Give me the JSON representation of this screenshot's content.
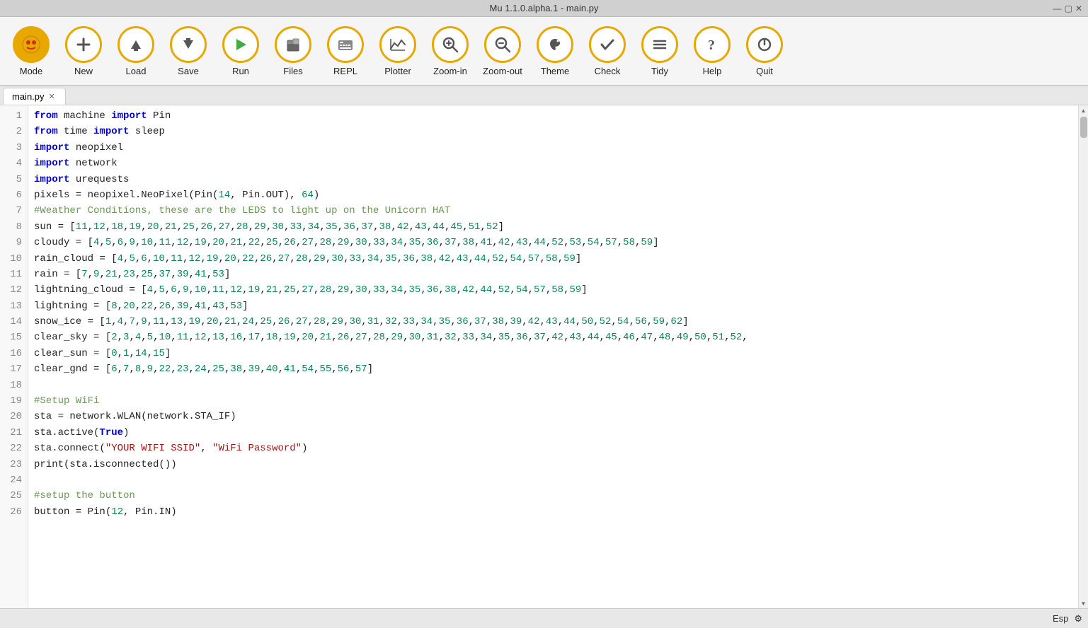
{
  "titleBar": {
    "title": "Mu 1.1.0.alpha.1 - main.py",
    "controls": [
      "▢",
      "—",
      "✕"
    ]
  },
  "toolbar": {
    "buttons": [
      {
        "id": "mode",
        "label": "Mode",
        "icon": "🔴",
        "special": "mode"
      },
      {
        "id": "new",
        "label": "New",
        "icon": "+"
      },
      {
        "id": "load",
        "label": "Load",
        "icon": "⬆"
      },
      {
        "id": "save",
        "label": "Save",
        "icon": "⬇"
      },
      {
        "id": "run",
        "label": "Run",
        "icon": "▶"
      },
      {
        "id": "files",
        "label": "Files",
        "icon": "📁"
      },
      {
        "id": "repl",
        "label": "REPL",
        "icon": "⌨"
      },
      {
        "id": "plotter",
        "label": "Plotter",
        "icon": "📈"
      },
      {
        "id": "zoom-in",
        "label": "Zoom-in",
        "icon": "🔍"
      },
      {
        "id": "zoom-out",
        "label": "Zoom-out",
        "icon": "🔎"
      },
      {
        "id": "theme",
        "label": "Theme",
        "icon": "🌙"
      },
      {
        "id": "check",
        "label": "Check",
        "icon": "👍"
      },
      {
        "id": "tidy",
        "label": "Tidy",
        "icon": "≡"
      },
      {
        "id": "help",
        "label": "Help",
        "icon": "?"
      },
      {
        "id": "quit",
        "label": "Quit",
        "icon": "⏻"
      }
    ]
  },
  "tabs": [
    {
      "id": "main-py",
      "label": "main.py",
      "active": true,
      "closeable": true
    }
  ],
  "statusBar": {
    "escLabel": "Esp",
    "settingsIcon": "⚙"
  }
}
